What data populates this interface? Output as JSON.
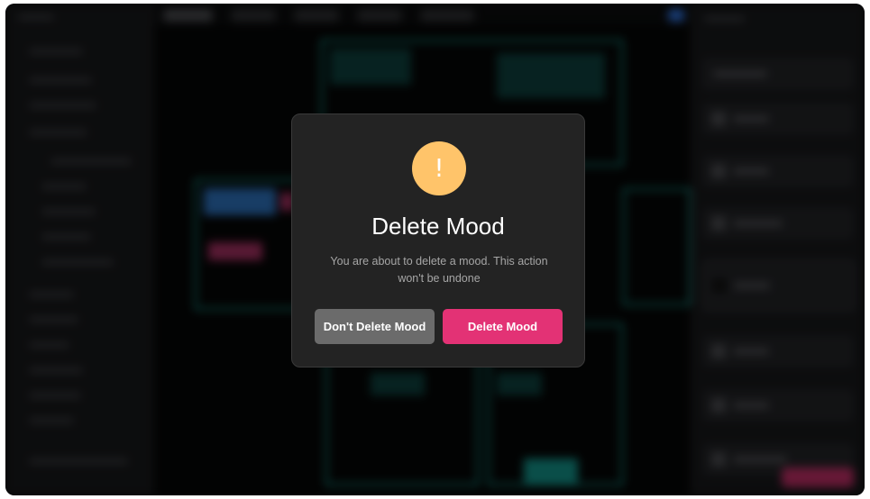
{
  "dialog": {
    "icon": "warning-icon",
    "icon_glyph": "!",
    "title": "Delete Mood",
    "message": "You are about to delete a mood. This action won't be undone",
    "cancel_label": "Don't Delete Mood",
    "confirm_label": "Delete Mood"
  },
  "colors": {
    "warning": "#ffc46a",
    "confirm": "#e33275",
    "cancel": "#6b6b6b",
    "dialog_bg": "#232323"
  }
}
